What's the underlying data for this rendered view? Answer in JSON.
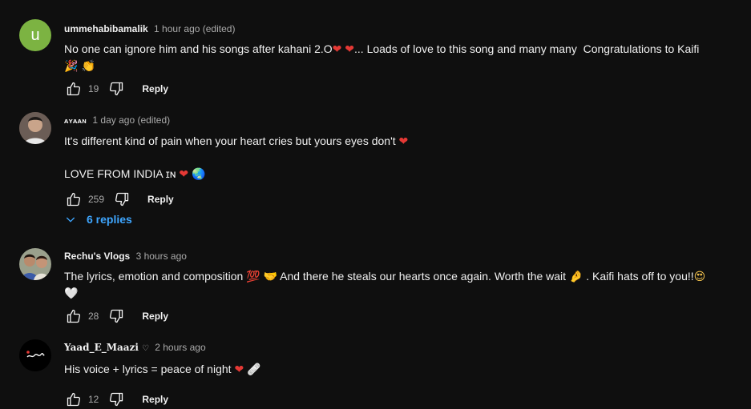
{
  "comments": [
    {
      "author": "ummehabibamalik",
      "avatar_letter": "u",
      "avatar_color": "#7cb342",
      "time": "1 hour ago (edited)",
      "text_line1": "No one can ignore him and his songs after kahani 2.O",
      "text_tail1": "... Loads of love to this song and many many  Congratulations to Kaifi",
      "emoji_line2": "🎉 👏",
      "likes": "19",
      "reply_label": "Reply"
    },
    {
      "author": "ᴀʏᴀᴀɴ",
      "time": "1 day ago (edited)",
      "text_line1": "It's different kind of pain when your heart cries but yours eyes don't",
      "text_line2": "LOVE FROM INDIA ɪɴ",
      "likes": "259",
      "reply_label": "Reply"
    },
    {
      "author": "Rechu's Vlogs",
      "time": "3 hours ago",
      "text_line1a": "The lyrics, emotion and composition",
      "text_line1b": "And there he steals our hearts once again. Worth the wait",
      "text_line1c": ". Kaifi hats off to you!!",
      "likes": "28",
      "reply_label": "Reply"
    },
    {
      "author": "Yaad_E_Maazi",
      "time": "2 hours ago",
      "text_line1": "His voice + lyrics = peace of night",
      "likes": "12",
      "reply_label": "Reply"
    }
  ],
  "replies_toggle": "6 replies",
  "colors": {
    "background": "#0f0f0f",
    "link": "#3ea6ff",
    "heart": "#e53935"
  }
}
